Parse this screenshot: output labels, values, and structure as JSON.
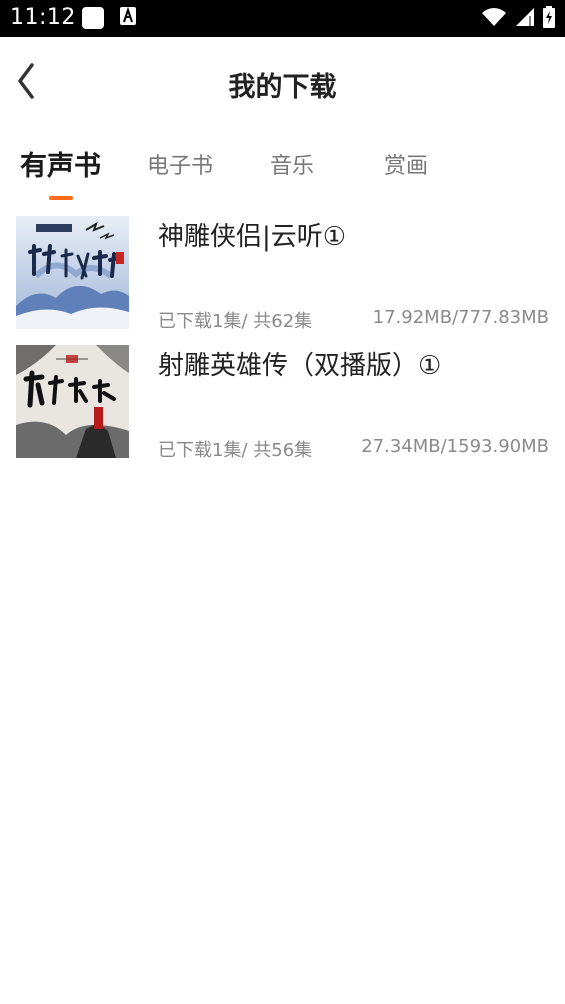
{
  "status_bar": {
    "time": "11:12",
    "icons": [
      "notification-square-icon",
      "font-a-icon",
      "wifi-icon",
      "signal-icon",
      "battery-icon"
    ]
  },
  "header": {
    "title": "我的下载",
    "back_icon": "chevron-left-icon"
  },
  "tabs": [
    {
      "label": "有声书",
      "active": true
    },
    {
      "label": "电子书",
      "active": false
    },
    {
      "label": "音乐",
      "active": false
    },
    {
      "label": "赏画",
      "active": false
    }
  ],
  "colors": {
    "accent": "#ff6a1a",
    "text_primary": "#222222",
    "text_secondary": "#8a8a8a"
  },
  "downloads": [
    {
      "title": "神雕侠侣|云听①",
      "downloaded": "已下载1集/ 共62集",
      "size": "17.92MB/777.83MB",
      "cover_icon": "book-cover-shendiao-icon"
    },
    {
      "title": "射雕英雄传（双播版）①",
      "downloaded": "已下载1集/ 共56集",
      "size": "27.34MB/1593.90MB",
      "cover_icon": "book-cover-shediao-icon"
    }
  ]
}
